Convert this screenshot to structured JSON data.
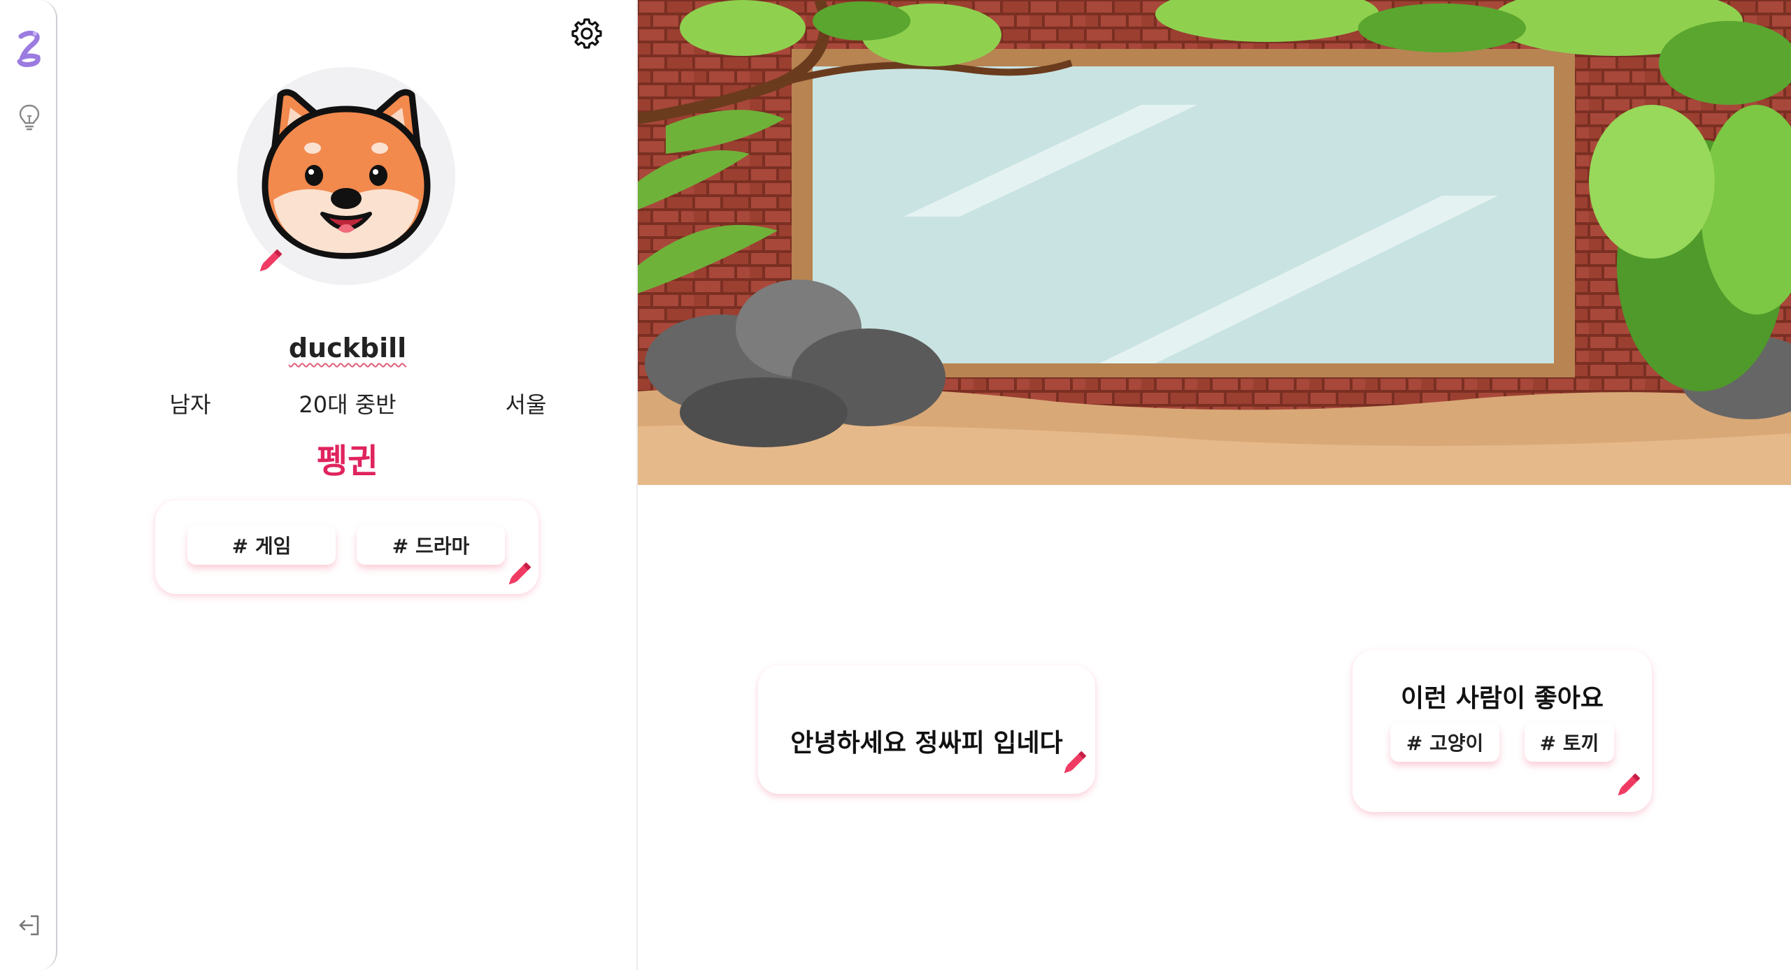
{
  "nav": {
    "logo_icon": "app-logo-icon",
    "items": [
      {
        "icon": "lightbulb-icon"
      }
    ],
    "logout_icon": "logout-icon"
  },
  "profile": {
    "settings_icon": "gear-icon",
    "avatar": "shiba-dog-avatar",
    "edit_icon": "pencil-icon",
    "username": "duckbill",
    "gender": "남자",
    "age": "20대 중반",
    "location": "서울",
    "animal_type": "펭귄",
    "interests": [
      "# 게임",
      "# 드라마"
    ]
  },
  "banner": {
    "scene": "brick-wall-window-plants"
  },
  "intro": {
    "text": "안녕하세요 정싸피 입네다"
  },
  "preferences": {
    "title": "이런 사람이 좋아요",
    "tags": [
      "# 고양이",
      "# 토끼"
    ]
  },
  "colors": {
    "accent": "#e0245e",
    "pencil": "#ef3b63",
    "card_shadow": "#f5a3b8",
    "logo": "#9b7be0"
  }
}
